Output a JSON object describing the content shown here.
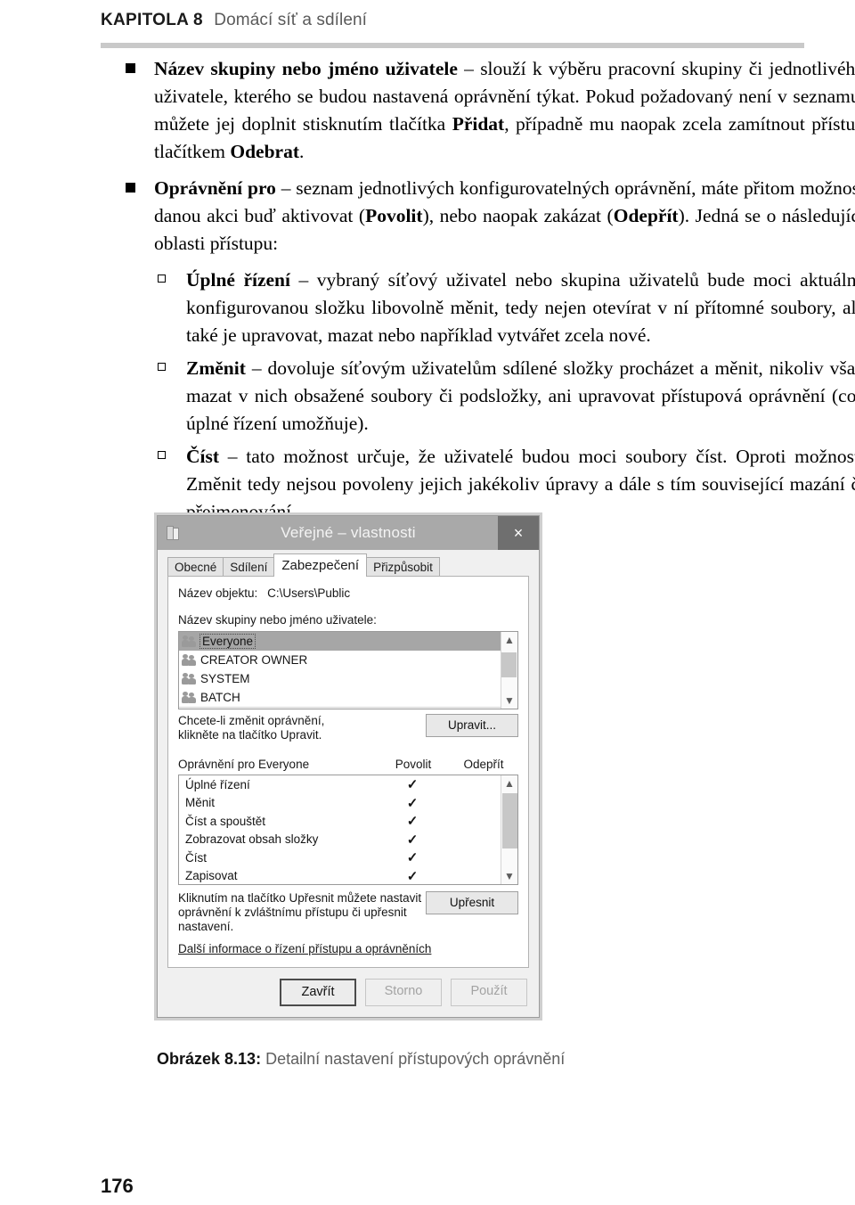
{
  "running_head": {
    "chapter_label": "KAPITOLA 8",
    "chapter_title": "Domácí síť a sdílení"
  },
  "folio": "176",
  "body": {
    "bullets": [
      {
        "level": 1,
        "marker": "filled-square",
        "segments": [
          {
            "bold": true,
            "text": "Název skupiny nebo jméno uživatele"
          },
          {
            "bold": false,
            "text": " – slouží k výběru pracovní skupiny či jednotlivého uživatele, kterého se budou nastavená oprávnění týkat. Pokud požadovaný není v seznamu, můžete jej doplnit stisknutím tlačítka "
          },
          {
            "bold": true,
            "text": "Přidat"
          },
          {
            "bold": false,
            "text": ", případně mu naopak zcela zamítnout přístup tlačítkem "
          },
          {
            "bold": true,
            "text": "Odebrat"
          },
          {
            "bold": false,
            "text": "."
          }
        ]
      },
      {
        "level": 1,
        "marker": "filled-square",
        "segments": [
          {
            "bold": true,
            "text": "Oprávnění pro"
          },
          {
            "bold": false,
            "text": " – seznam jednotlivých konfigurovatelných oprávnění, máte přitom možnost danou akci buď aktivovat ("
          },
          {
            "bold": true,
            "text": "Povolit"
          },
          {
            "bold": false,
            "text": "), nebo naopak zakázat ("
          },
          {
            "bold": true,
            "text": "Odepřít"
          },
          {
            "bold": false,
            "text": "). Jedná se o následující oblasti přístupu:"
          }
        ]
      },
      {
        "level": 2,
        "marker": "hollow-square",
        "segments": [
          {
            "bold": true,
            "text": "Úplné řízení"
          },
          {
            "bold": false,
            "text": " – vybraný síťový uživatel nebo skupina uživatelů bude moci aktuálně konfigurovanou složku libovolně měnit, tedy nejen otevírat v ní přítomné soubory, ale také je upravovat, mazat nebo například vytvářet zcela nové."
          }
        ]
      },
      {
        "level": 2,
        "marker": "hollow-square",
        "segments": [
          {
            "bold": true,
            "text": "Změnit"
          },
          {
            "bold": false,
            "text": " – dovoluje síťovým uživatelům sdílené složky procházet a měnit, nikoliv však mazat v nich obsažené soubory či podsložky, ani upravovat přístupová oprávnění (což úplné řízení umožňuje)."
          }
        ]
      },
      {
        "level": 2,
        "marker": "hollow-square",
        "segments": [
          {
            "bold": true,
            "text": "Číst"
          },
          {
            "bold": false,
            "text": " – tato možnost určuje, že uživatelé budou moci soubory číst. Oproti možnosti Změnit tedy nejsou povoleny jejich jakékoliv úpravy a dále s tím související mazání či přejmenování."
          }
        ]
      }
    ]
  },
  "figure": {
    "caption_label": "Obrázek 8.13:",
    "caption_text": "Detailní nastavení přístupových oprávnění",
    "dialog": {
      "window_icon": "folder-icon",
      "title": "Veřejné – vlastnosti",
      "close_label": "×",
      "tabs": [
        {
          "label": "Obecné",
          "active": false
        },
        {
          "label": "Sdílení",
          "active": false
        },
        {
          "label": "Zabezpečení",
          "active": true
        },
        {
          "label": "Přizpůsobit",
          "active": false
        }
      ],
      "object_name_label": "Název objektu:",
      "object_name_value": "C:\\Users\\Public",
      "users_label": "Název skupiny nebo jméno uživatele:",
      "users": [
        {
          "name": "Everyone",
          "selected": true
        },
        {
          "name": "CREATOR OWNER",
          "selected": false
        },
        {
          "name": "SYSTEM",
          "selected": false
        },
        {
          "name": "BATCH",
          "selected": false
        }
      ],
      "edit_hint_line1": "Chcete-li změnit oprávnění,",
      "edit_hint_line2": "klikněte na tlačítko Upravit.",
      "edit_button": "Upravit...",
      "perm_header_label": "Oprávnění pro Everyone",
      "perm_col_allow": "Povolit",
      "perm_col_deny": "Odepřít",
      "permissions": [
        {
          "name": "Úplné řízení",
          "allow": "✓",
          "deny": ""
        },
        {
          "name": "Měnit",
          "allow": "✓",
          "deny": ""
        },
        {
          "name": "Číst a spouštět",
          "allow": "✓",
          "deny": ""
        },
        {
          "name": "Zobrazovat obsah složky",
          "allow": "✓",
          "deny": ""
        },
        {
          "name": "Číst",
          "allow": "✓",
          "deny": ""
        },
        {
          "name": "Zapisovat",
          "allow": "✓",
          "deny": ""
        }
      ],
      "adv_hint_line1": "Kliknutím na tlačítko Upřesnit můžete nastavit",
      "adv_hint_line2": "oprávnění k zvláštnímu přístupu či upřesnit",
      "adv_hint_line3": "nastavení.",
      "adv_button": "Upřesnit",
      "more_info_link": "Další informace o řízení přístupu a oprávněních",
      "buttons": [
        {
          "label": "Zavřít",
          "state": "default"
        },
        {
          "label": "Storno",
          "state": "disabled"
        },
        {
          "label": "Použít",
          "state": "disabled"
        }
      ]
    }
  },
  "colors": {
    "rule": "#c9c9c9",
    "titlebar": "#a9a9a9",
    "selection": "#a6a6a6",
    "caption_text": "#5f5f5f"
  }
}
